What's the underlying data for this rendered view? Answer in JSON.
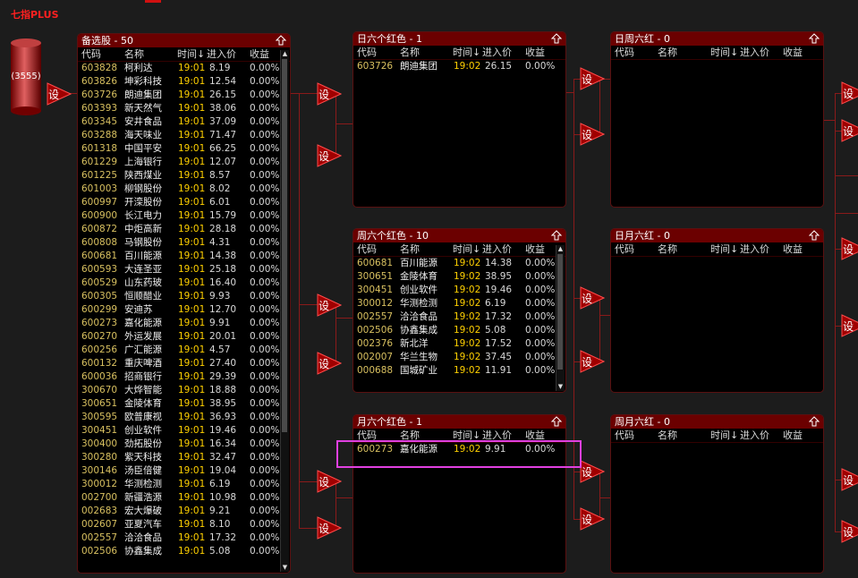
{
  "app": {
    "title": "七指PLUS"
  },
  "pool": {
    "count": "(3555)"
  },
  "set_label": "设",
  "headers": {
    "code": "代码",
    "name": "名称",
    "time": "时间↓",
    "price": "进入价",
    "pct": "收益"
  },
  "panels": {
    "watchlist": {
      "title": "备选股 - 50",
      "rows": [
        [
          "603828",
          "柯利达",
          "19:01",
          "8.19",
          "0.00%"
        ],
        [
          "603826",
          "坤彩科技",
          "19:01",
          "12.54",
          "0.00%"
        ],
        [
          "603726",
          "朗迪集团",
          "19:01",
          "26.15",
          "0.00%"
        ],
        [
          "603393",
          "新天然气",
          "19:01",
          "38.06",
          "0.00%"
        ],
        [
          "603345",
          "安井食品",
          "19:01",
          "37.09",
          "0.00%"
        ],
        [
          "603288",
          "海天味业",
          "19:01",
          "71.47",
          "0.00%"
        ],
        [
          "601318",
          "中国平安",
          "19:01",
          "66.25",
          "0.00%"
        ],
        [
          "601229",
          "上海银行",
          "19:01",
          "12.07",
          "0.00%"
        ],
        [
          "601225",
          "陕西煤业",
          "19:01",
          "8.57",
          "0.00%"
        ],
        [
          "601003",
          "柳钢股份",
          "19:01",
          "8.02",
          "0.00%"
        ],
        [
          "600997",
          "开滦股份",
          "19:01",
          "6.01",
          "0.00%"
        ],
        [
          "600900",
          "长江电力",
          "19:01",
          "15.79",
          "0.00%"
        ],
        [
          "600872",
          "中炬高新",
          "19:01",
          "28.18",
          "0.00%"
        ],
        [
          "600808",
          "马钢股份",
          "19:01",
          "4.31",
          "0.00%"
        ],
        [
          "600681",
          "百川能源",
          "19:01",
          "14.38",
          "0.00%"
        ],
        [
          "600593",
          "大连圣亚",
          "19:01",
          "25.18",
          "0.00%"
        ],
        [
          "600529",
          "山东药玻",
          "19:01",
          "16.40",
          "0.00%"
        ],
        [
          "600305",
          "恒顺醋业",
          "19:01",
          "9.93",
          "0.00%"
        ],
        [
          "600299",
          "安迪苏",
          "19:01",
          "12.70",
          "0.00%"
        ],
        [
          "600273",
          "嘉化能源",
          "19:01",
          "9.91",
          "0.00%"
        ],
        [
          "600270",
          "外运发展",
          "19:01",
          "20.01",
          "0.00%"
        ],
        [
          "600256",
          "广汇能源",
          "19:01",
          "4.57",
          "0.00%"
        ],
        [
          "600132",
          "重庆啤酒",
          "19:01",
          "27.40",
          "0.00%"
        ],
        [
          "600036",
          "招商银行",
          "19:01",
          "29.39",
          "0.00%"
        ],
        [
          "300670",
          "大烨智能",
          "19:01",
          "18.88",
          "0.00%"
        ],
        [
          "300651",
          "金陵体育",
          "19:01",
          "38.95",
          "0.00%"
        ],
        [
          "300595",
          "欧普康视",
          "19:01",
          "36.93",
          "0.00%"
        ],
        [
          "300451",
          "创业软件",
          "19:01",
          "19.46",
          "0.00%"
        ],
        [
          "300400",
          "劲拓股份",
          "19:01",
          "16.34",
          "0.00%"
        ],
        [
          "300280",
          "紫天科技",
          "19:01",
          "32.47",
          "0.00%"
        ],
        [
          "300146",
          "汤臣倍健",
          "19:01",
          "19.04",
          "0.00%"
        ],
        [
          "300012",
          "华测检测",
          "19:01",
          "6.19",
          "0.00%"
        ],
        [
          "002700",
          "新疆浩源",
          "19:01",
          "10.98",
          "0.00%"
        ],
        [
          "002683",
          "宏大爆破",
          "19:01",
          "9.21",
          "0.00%"
        ],
        [
          "002607",
          "亚夏汽车",
          "19:01",
          "8.10",
          "0.00%"
        ],
        [
          "002557",
          "洽洽食品",
          "19:01",
          "17.32",
          "0.00%"
        ],
        [
          "002506",
          "协鑫集成",
          "19:01",
          "5.08",
          "0.00%"
        ]
      ]
    },
    "daily": {
      "title": "日六个红色 - 1",
      "rows": [
        [
          "603726",
          "朗迪集团",
          "19:02",
          "26.15",
          "0.00%"
        ]
      ]
    },
    "weekly": {
      "title": "周六个红色 - 10",
      "rows": [
        [
          "600681",
          "百川能源",
          "19:02",
          "14.38",
          "0.00%"
        ],
        [
          "300651",
          "金陵体育",
          "19:02",
          "38.95",
          "0.00%"
        ],
        [
          "300451",
          "创业软件",
          "19:02",
          "19.46",
          "0.00%"
        ],
        [
          "300012",
          "华测检测",
          "19:02",
          "6.19",
          "0.00%"
        ],
        [
          "002557",
          "洽洽食品",
          "19:02",
          "17.32",
          "0.00%"
        ],
        [
          "002506",
          "协鑫集成",
          "19:02",
          "5.08",
          "0.00%"
        ],
        [
          "002376",
          "新北洋",
          "19:02",
          "17.52",
          "0.00%"
        ],
        [
          "002007",
          "华兰生物",
          "19:02",
          "37.45",
          "0.00%"
        ],
        [
          "000688",
          "国城矿业",
          "19:02",
          "11.91",
          "0.00%"
        ]
      ]
    },
    "monthly": {
      "title": "月六个红色 - 1",
      "rows": [
        [
          "600273",
          "嘉化能源",
          "19:02",
          "9.91",
          "0.00%"
        ]
      ]
    },
    "day_week": {
      "title": "日周六红 - 0",
      "rows": []
    },
    "day_month": {
      "title": "日月六红 - 0",
      "rows": []
    },
    "week_month": {
      "title": "周月六红 - 0",
      "rows": []
    }
  }
}
